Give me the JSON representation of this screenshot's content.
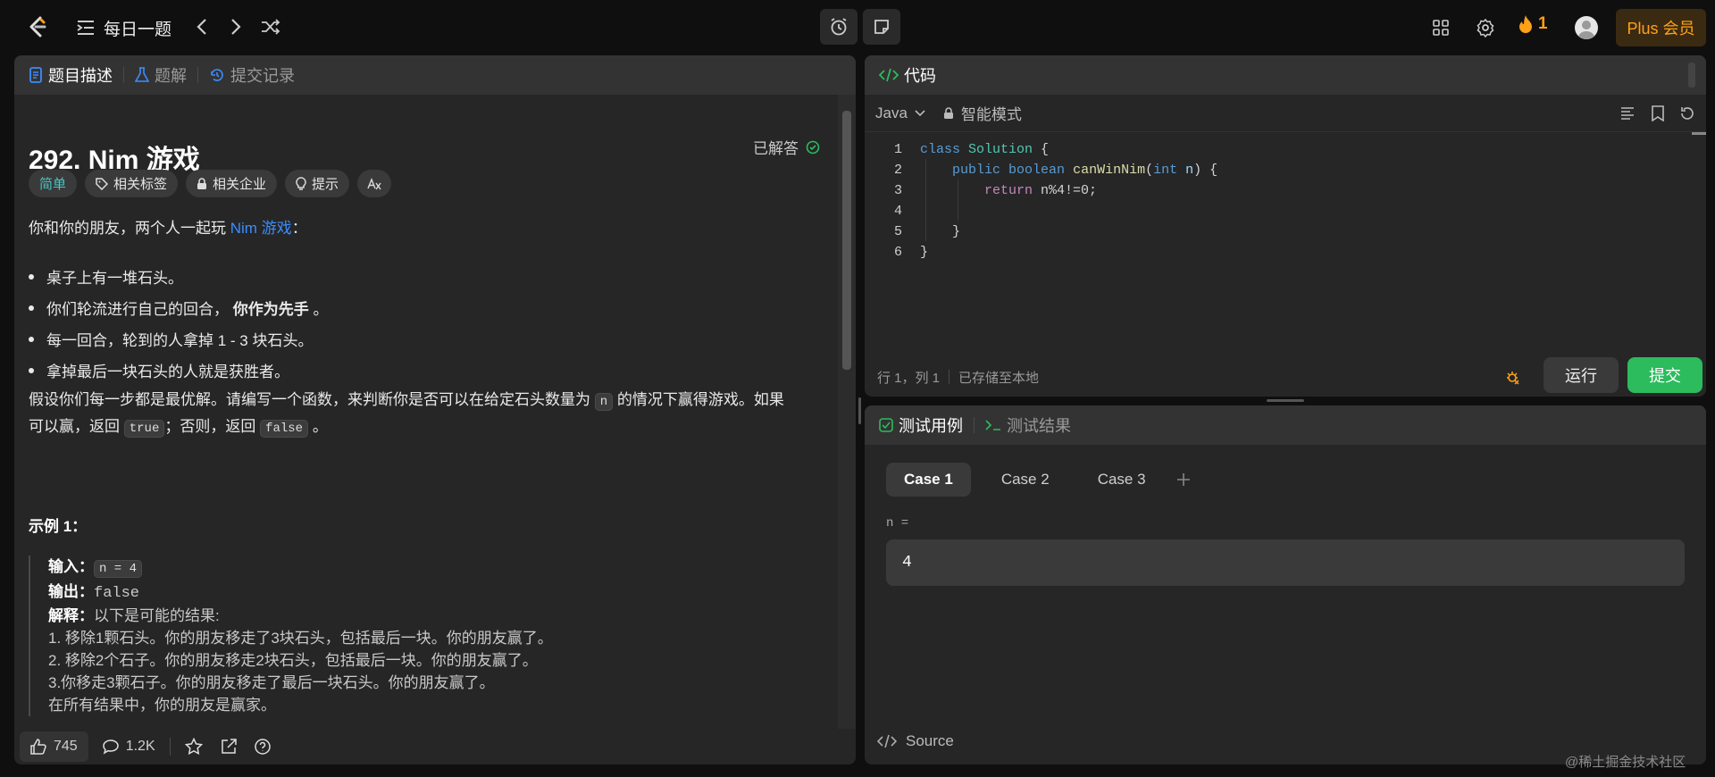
{
  "topbar": {
    "daily_label": "每日一题",
    "streak": "1",
    "plus_label": "Plus 会员"
  },
  "left": {
    "tabs": [
      "题目描述",
      "题解",
      "提交记录"
    ],
    "title": "292. Nim 游戏",
    "solved": "已解答",
    "chips": [
      "简单",
      "相关标签",
      "相关企业",
      "提示"
    ],
    "intro_prefix": "你和你的朋友，两个人一起玩 ",
    "intro_link": "Nim 游戏",
    "intro_suffix": "：",
    "bullets": [
      "桌子上有一堆石头。",
      "你们轮流进行自己的回合，",
      "每一回合，轮到的人拿掉 1 - 3 块石头。",
      "拿掉最后一块石头的人就是获胜者。"
    ],
    "bullet2_bold": "你作为先手",
    "bullet2_end": "。",
    "question_1": "假设你们每一步都是最优解。请编写一个函数，来判断你是否可以在给定石头数量为",
    "question_n": "n",
    "question_2": "的情况下赢得游戏。如果",
    "question_3": "可以赢，返回",
    "question_true": "true",
    "question_4": "；否则，返回",
    "question_false": "false",
    "question_5": "。",
    "example_title": "示例 1：",
    "example": {
      "input_label": "输入：",
      "input_value": "n = 4",
      "output_label": "输出：",
      "output_value": "false",
      "explain_label": "解释：",
      "explain_value": "以下是可能的结果:",
      "lines": [
        "1. 移除1颗石头。你的朋友移走了3块石头，包括最后一块。你的朋友赢了。",
        "2. 移除2个石子。你的朋友移走2块石头，包括最后一块。你的朋友赢了。",
        "3.你移走3颗石子。你的朋友移走了最后一块石头。你的朋友赢了。",
        "在所有结果中，你的朋友是赢家。"
      ]
    },
    "footer": {
      "likes": "745",
      "comments": "1.2K"
    }
  },
  "code": {
    "header": "代码",
    "language": "Java",
    "mode": "智能模式",
    "lines": [
      {
        "n": "1"
      },
      {
        "n": "2"
      },
      {
        "n": "3"
      },
      {
        "n": "4"
      },
      {
        "n": "5"
      },
      {
        "n": "6"
      }
    ],
    "tokens": {
      "class": "class",
      "Solution": "Solution",
      "brace_open": " {",
      "public": "public",
      "boolean": "boolean",
      "method": "canWinNim",
      "paren_open": "(",
      "int": "int",
      "param": "n",
      "paren_close": ") {",
      "return": "return",
      "expr": " n%4!=0;",
      "close_inner": "}",
      "close_outer": "}"
    },
    "status": "行 1，列 1",
    "saved": "已存储至本地",
    "run": "运行",
    "submit": "提交"
  },
  "test": {
    "tabs": [
      "测试用例",
      "测试结果"
    ],
    "cases": [
      "Case 1",
      "Case 2",
      "Case 3"
    ],
    "var_label": "n =",
    "var_value": "4",
    "source": "Source"
  },
  "watermark": "@稀土掘金技术社区",
  "colors": {
    "accent": "#ffa116",
    "submit_green": "#2cbb5d",
    "easy_teal": "#46c6c2",
    "link_blue": "#3c8cff"
  }
}
